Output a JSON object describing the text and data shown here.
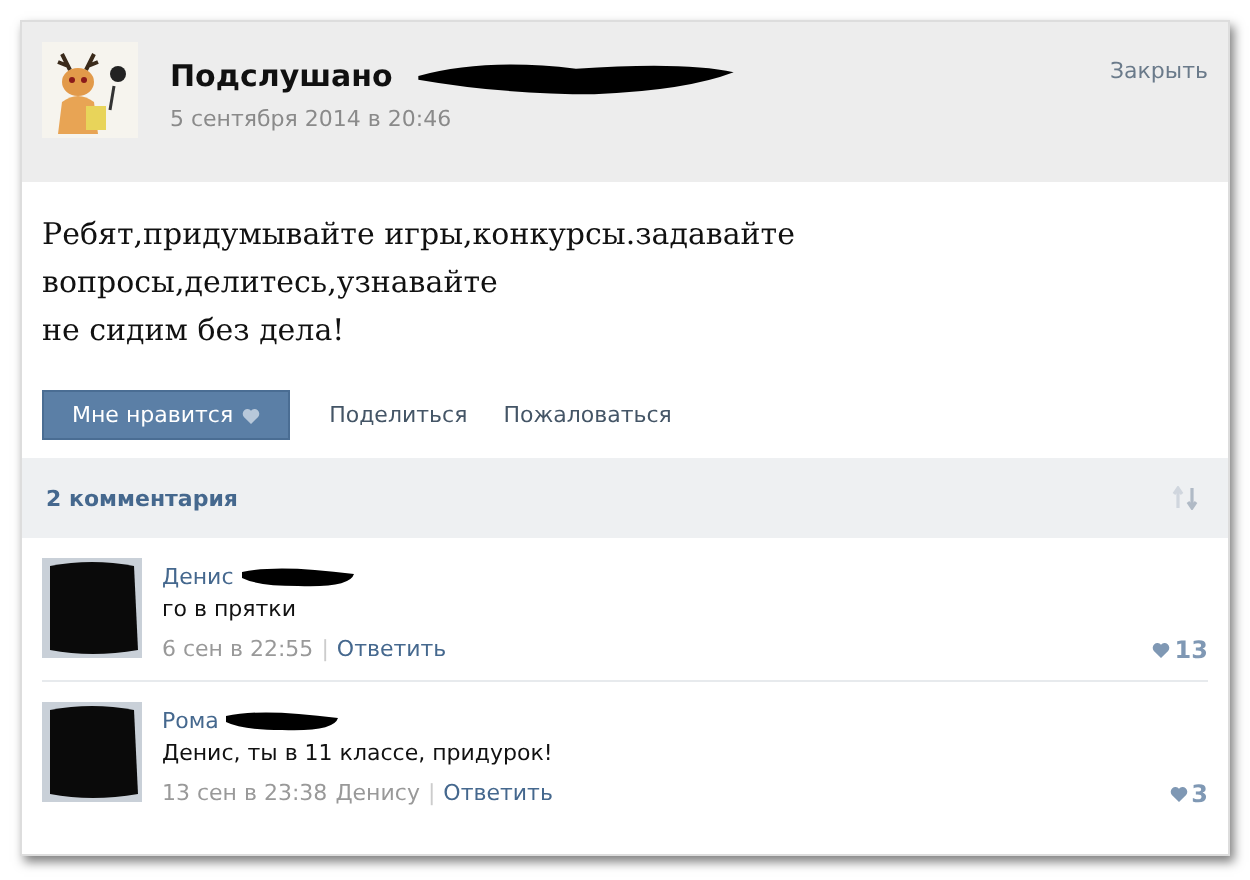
{
  "post": {
    "author": "Подслушано",
    "author_redacted": true,
    "date": "5 сентября 2014 в 20:46",
    "close": "Закрыть",
    "text_lines": [
      "Ребят,придумывайте игры,конкурсы.задавайте",
      "вопросы,делитесь,узнавайте",
      "не сидим без дела!"
    ],
    "like_button": "Мне нравится",
    "actions": [
      "Поделиться",
      "Пожаловаться"
    ]
  },
  "comments_header": {
    "count": "2 комментария"
  },
  "comments": [
    {
      "author": "Денис",
      "author_redacted": true,
      "avatar_redacted": true,
      "text": "го в прятки",
      "time": "6 сен в 22:55",
      "separator": "|",
      "reply": "Ответить",
      "likes": "13"
    },
    {
      "author": "Рома",
      "author_redacted": true,
      "avatar_redacted": true,
      "text": "Денис, ты в 11 классе, придурок!",
      "time": "13 сен в 23:38",
      "reply_to": "Денису",
      "separator": "|",
      "reply": "Ответить",
      "likes": "3"
    }
  ]
}
